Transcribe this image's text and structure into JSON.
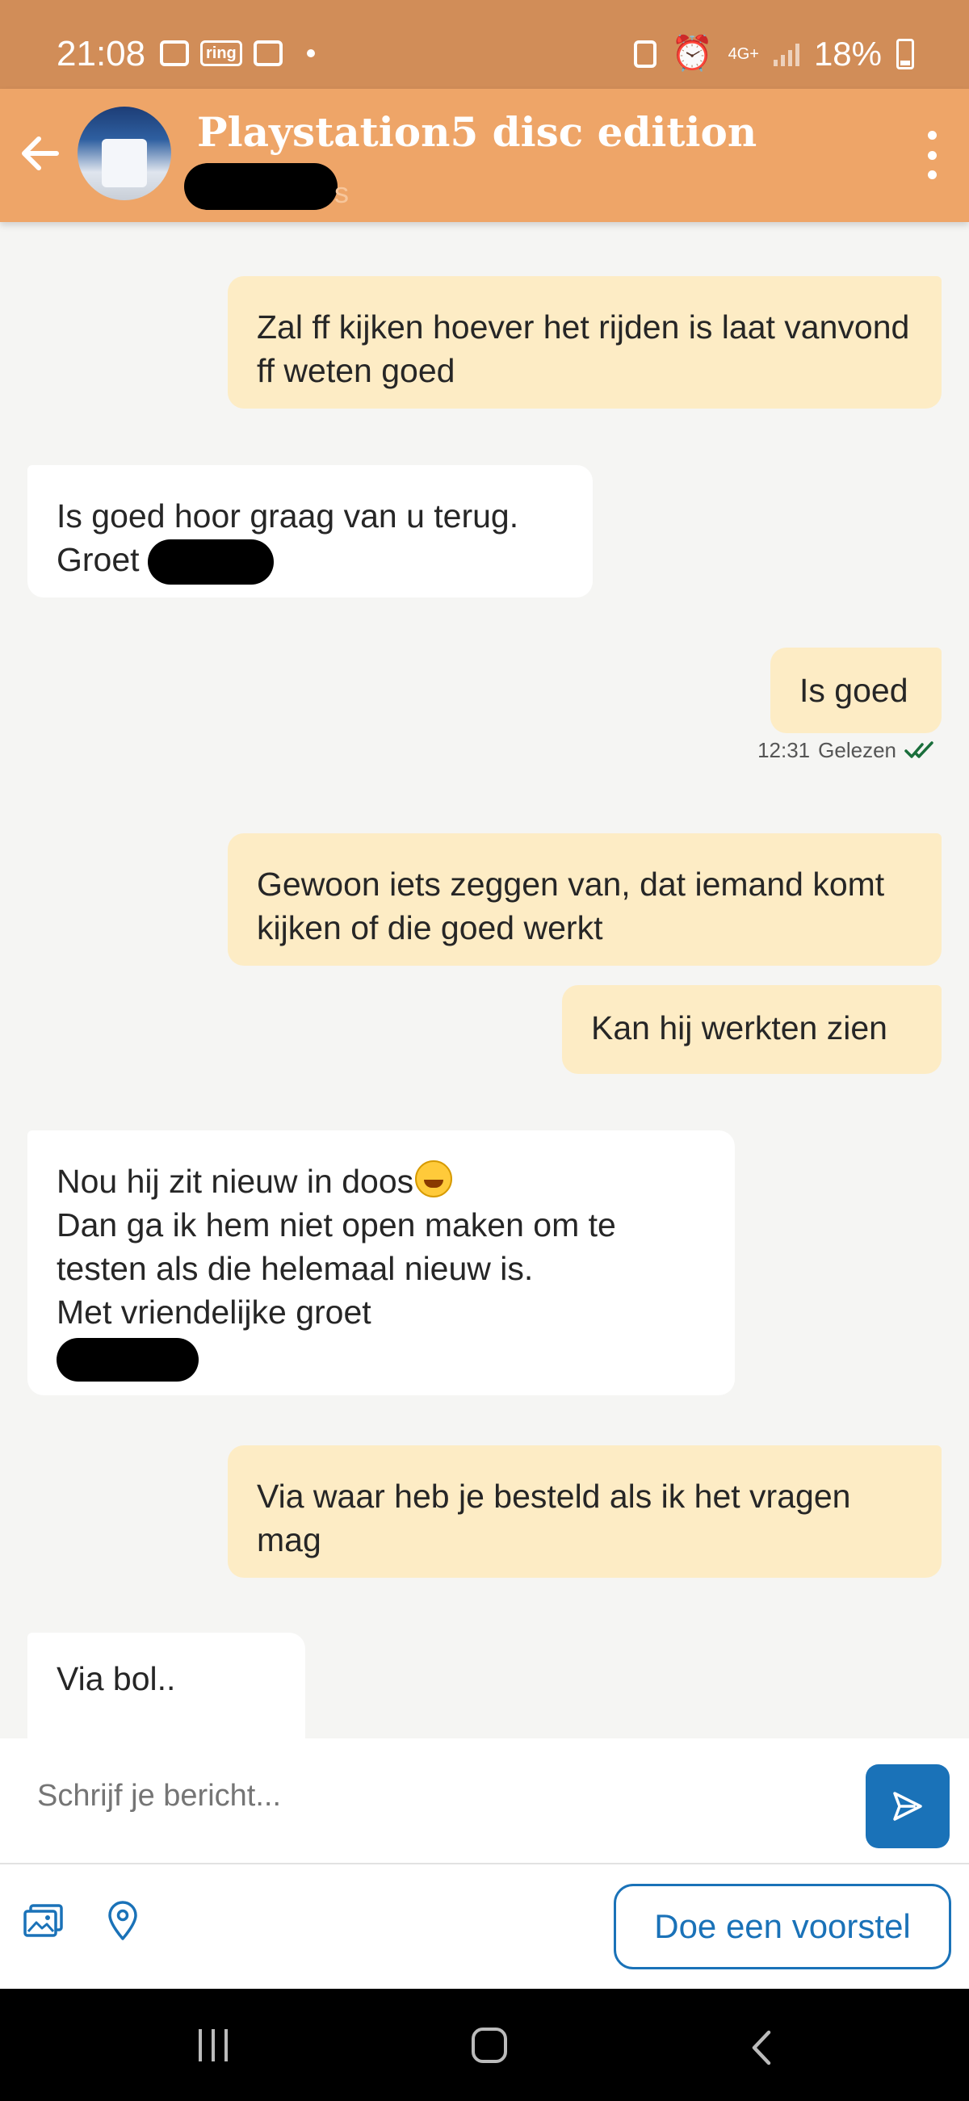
{
  "status_bar": {
    "time": "21:08",
    "ring_label": "ring",
    "network": "4G+",
    "battery": "18%"
  },
  "header": {
    "title": "Playstation5 disc edition",
    "subtitle_tail": "s"
  },
  "messages": [
    {
      "direction": "out",
      "text": "Zal ff kijken hoever het rijden is laat vanvond ff weten goed"
    },
    {
      "direction": "in",
      "line1": "Is goed hoor graag van u terug.",
      "line2": "Groet"
    },
    {
      "direction": "out",
      "text": "Is goed",
      "time": "12:31",
      "status": "Gelezen"
    },
    {
      "direction": "out",
      "text": "Gewoon iets zeggen van, dat iemand komt kijken of die goed werkt"
    },
    {
      "direction": "out",
      "text": "Kan hij werkten zien"
    },
    {
      "direction": "in",
      "line1": "Nou hij zit nieuw in doos",
      "line2": "Dan ga ik hem niet open maken om te testen als die helemaal nieuw is.",
      "line3": "Met vriendelijke groet"
    },
    {
      "direction": "out",
      "text": "Via waar heb je besteld als ik het vragen mag"
    },
    {
      "direction": "in",
      "text": "Via bol.."
    }
  ],
  "composer": {
    "placeholder": "Schrijf je bericht...",
    "propose_label": "Doe een voorstel"
  },
  "icons": {
    "back": "arrow-left-icon",
    "menu": "more-vertical-icon",
    "send": "send-icon",
    "photo": "photo-icon",
    "location": "location-pin-icon",
    "read": "double-check-icon"
  },
  "colors": {
    "status_bar": "#d18d58",
    "header": "#eea568",
    "outgoing_bubble": "#fdecc5",
    "incoming_bubble": "#ffffff",
    "accent": "#1a72b8"
  }
}
